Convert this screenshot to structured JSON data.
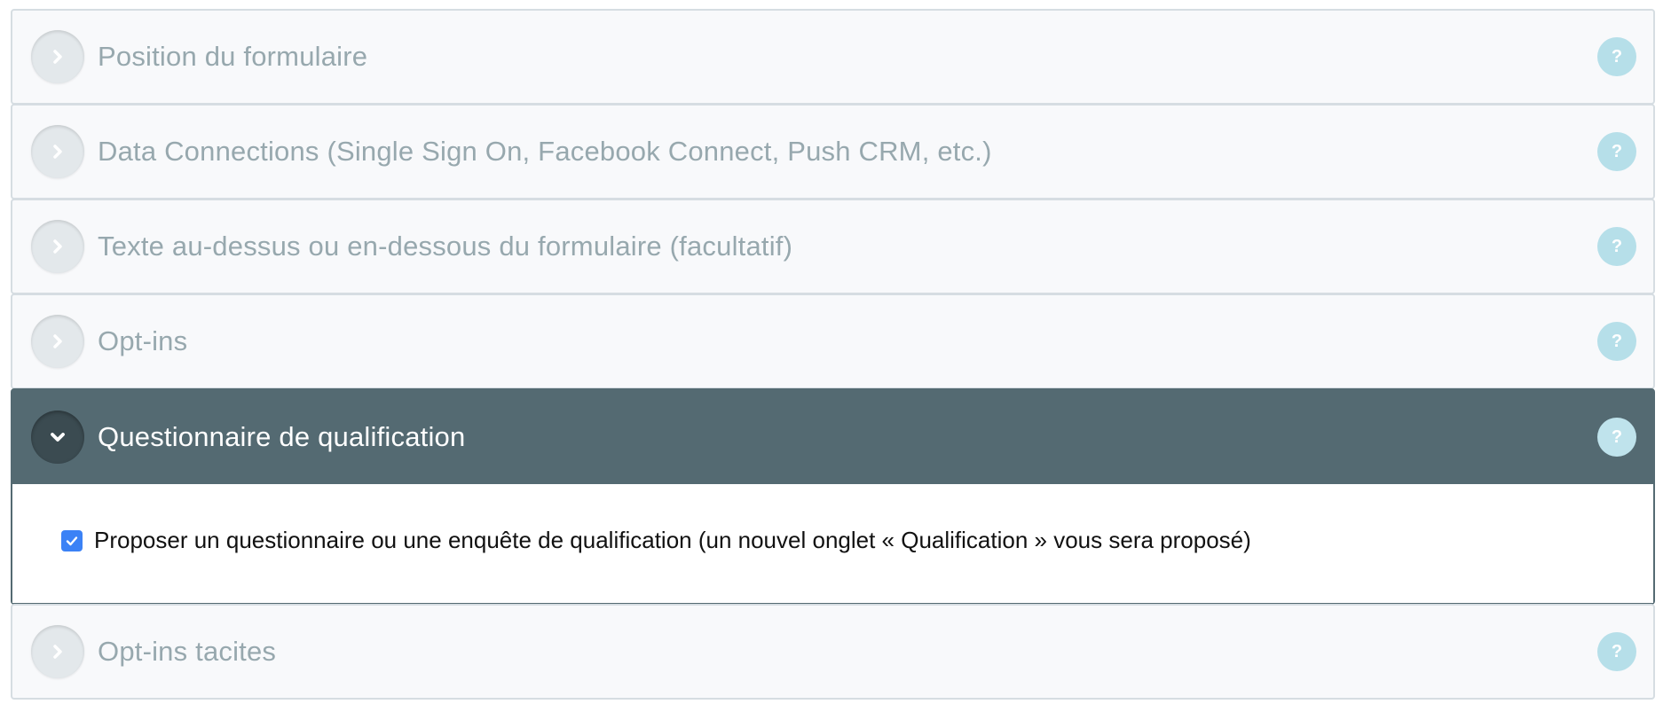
{
  "panels": [
    {
      "title": "Position du formulaire",
      "help": "?",
      "state": "collapsed",
      "toggle_icon": "chevron-right-icon"
    },
    {
      "title": "Data Connections (Single Sign On, Facebook Connect, Push CRM, etc.)",
      "help": "?",
      "state": "collapsed",
      "toggle_icon": "chevron-right-icon"
    },
    {
      "title": "Texte au-dessus ou en-dessous du formulaire (facultatif)",
      "help": "?",
      "state": "collapsed",
      "toggle_icon": "chevron-right-icon"
    },
    {
      "title": "Opt-ins",
      "help": "?",
      "state": "collapsed",
      "toggle_icon": "chevron-right-icon"
    },
    {
      "title": "Questionnaire de qualification",
      "help": "?",
      "state": "expanded",
      "toggle_icon": "chevron-down-icon",
      "body": {
        "checkbox_checked": true,
        "checkbox_label": "Proposer un questionnaire ou une enquête de qualification (un nouvel onglet « Qualification » vous sera proposé)"
      }
    },
    {
      "title": "Opt-ins tacites",
      "help": "?",
      "state": "collapsed",
      "toggle_icon": "chevron-right-icon"
    }
  ],
  "colors": {
    "active_header": "#546a72",
    "inactive_title": "#97a8ae",
    "help_badge": "#b6dfe9",
    "checkbox": "#3b82f6"
  }
}
